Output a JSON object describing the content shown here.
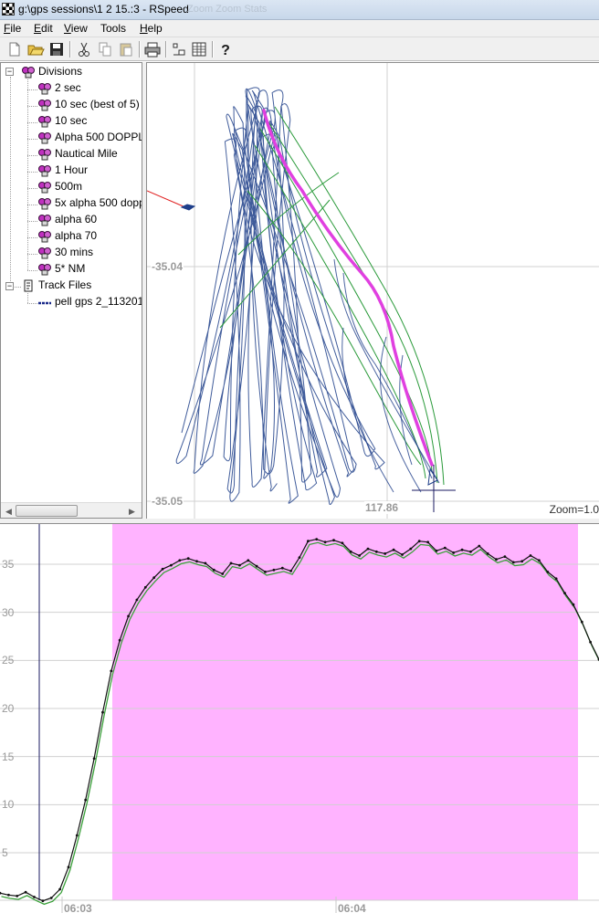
{
  "window": {
    "title": "g:\\gps sessions\\1 2 15.:3 - RSpeed",
    "ghost_title": "Zoom   Zoom   Stats"
  },
  "menu": [
    {
      "label": "File",
      "underline": "F"
    },
    {
      "label": "Edit",
      "underline": "E"
    },
    {
      "label": "View",
      "underline": "V"
    },
    {
      "label": "Tools",
      "underline": ""
    },
    {
      "label": "Help",
      "underline": "H"
    }
  ],
  "toolbar": {
    "buttons": [
      "new-icon",
      "open-icon",
      "save-icon",
      "cut-icon",
      "copy-icon",
      "paste-icon",
      "print-icon",
      "scale-icon",
      "table-icon",
      "help-icon"
    ]
  },
  "tree": {
    "divisions_label": "Divisions",
    "divisions": [
      "2 sec",
      "10 sec (best of 5)",
      "10 sec",
      "Alpha 500 DOPPL",
      "Nautical Mile",
      "1 Hour",
      "500m",
      "5x alpha 500 dopp",
      "alpha 60",
      "alpha 70",
      "30 mins",
      "5* NM"
    ],
    "track_files_label": "Track Files",
    "track_files": [
      "pell gps 2_113201"
    ]
  },
  "map": {
    "lat_labels": [
      "-35.04",
      "-35.05"
    ],
    "lon_label": "117.86",
    "zoom": "Zoom=1.0",
    "colors": {
      "track_dark": "#1f3f8a",
      "track_green": "#2a9a3a",
      "highlight": "#e040e0",
      "heading": "#e02020"
    }
  },
  "chart": {
    "y_ticks": [
      "35",
      "30",
      "25",
      "20",
      "15",
      "10",
      "5"
    ],
    "x_ticks": [
      "06:03",
      "06:04"
    ],
    "highlight_color": "#ffb3ff"
  },
  "chart_data": {
    "type": "line",
    "ylabel": "",
    "xlabel": "",
    "ylim": [
      -2,
      37.5
    ],
    "x_ticks": [
      "06:03",
      "06:04"
    ],
    "series": [
      {
        "values": [
          0.8,
          0.6,
          0.5,
          0.9,
          0.4,
          0.0,
          0.3,
          1.2,
          3.5,
          6.8,
          10.5,
          14.8,
          19.6,
          23.9,
          27.1,
          29.6,
          31.3,
          32.6,
          33.6,
          34.5,
          34.9,
          35.4,
          35.6,
          35.3,
          35.1,
          34.4,
          34.0,
          35.1,
          34.9,
          35.4,
          34.8,
          34.2,
          34.4,
          34.6,
          34.3,
          35.7,
          37.4,
          37.6,
          37.3,
          37.5,
          37.2,
          36.3,
          35.9,
          36.6,
          36.3,
          36.1,
          36.5,
          36.0,
          36.6,
          37.4,
          37.3,
          36.4,
          36.7,
          36.2,
          36.5,
          36.3,
          36.9,
          36.1,
          35.5,
          35.8,
          35.2,
          35.3,
          35.9,
          35.4,
          34.2,
          33.5,
          32.0,
          30.8,
          29.0,
          26.9,
          25.1
        ]
      }
    ]
  }
}
